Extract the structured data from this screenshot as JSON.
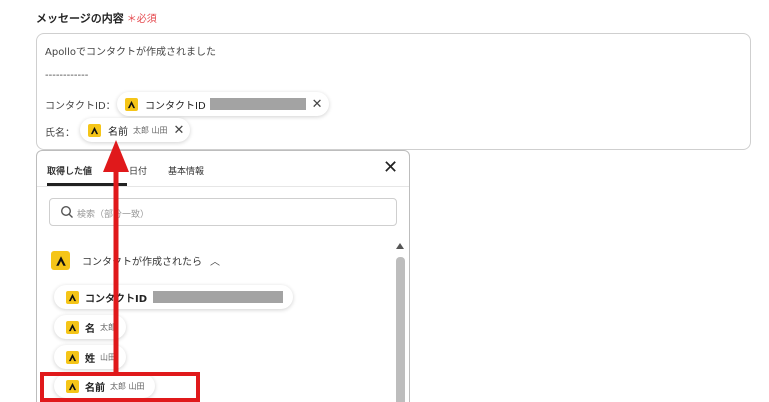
{
  "field": {
    "label": "メッセージの内容",
    "required_mark": "＊必須"
  },
  "message": {
    "line1": "Apolloでコンタクトが作成されました",
    "line2": "------------",
    "line3_prefix": "コンタクトID：",
    "line4_prefix": "氏名：",
    "chip_contact_id": {
      "label": "コンタクトID"
    },
    "chip_name": {
      "label": "名前",
      "sample": "太郎 山田"
    }
  },
  "panel": {
    "tabs": [
      "取得した値",
      "日付",
      "基本情報"
    ],
    "search_placeholder": "検索（部分一致）",
    "section_label": "コンタクトが作成されたら",
    "items": [
      {
        "label": "コンタクトID",
        "sample": ""
      },
      {
        "label": "名",
        "sample": "太郎"
      },
      {
        "label": "姓",
        "sample": "山田"
      },
      {
        "label": "名前",
        "sample": "太郎 山田"
      }
    ]
  },
  "colors": {
    "accent": "#f5c518",
    "annotation": "#e0191b"
  }
}
